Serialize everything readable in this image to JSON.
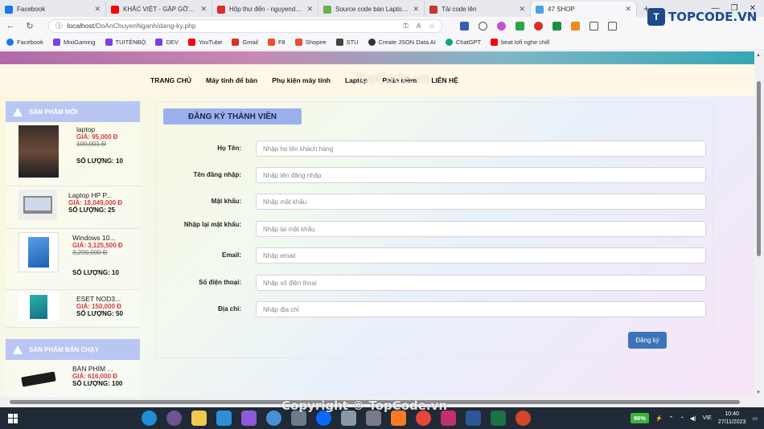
{
  "browser": {
    "tabs": [
      {
        "title": "Facebook",
        "color": "#1877f2"
      },
      {
        "title": "KHẮC VIỆT - GẶP GỠ ĐỂ CHIA LY",
        "color": "#ff0000"
      },
      {
        "title": "Hộp thư đến - nguyenducch",
        "color": "#d93025"
      },
      {
        "title": "Source code bán Laptop - P",
        "color": "#6ab04c"
      },
      {
        "title": "Tải code lên",
        "color": "#c0392b"
      },
      {
        "title": "47 SHOP",
        "color": "#4aa3df"
      }
    ],
    "url_host": "localhost",
    "url_path": "/DoAnChuyenNganh/dang-ky.php",
    "bookmarks": [
      {
        "label": "Facebook",
        "color": "#1877f2"
      },
      {
        "label": "MixiGaming",
        "color": "#7b3fe4"
      },
      {
        "label": "TUITÈNBỘ",
        "color": "#7b3fe4"
      },
      {
        "label": "DEV",
        "color": "#7b3fe4"
      },
      {
        "label": "YouTube",
        "color": "#ff0000"
      },
      {
        "label": "Gmail",
        "color": "#d93025"
      },
      {
        "label": "F8",
        "color": "#f05123"
      },
      {
        "label": "Shopee",
        "color": "#ee4d2d"
      },
      {
        "label": "STU",
        "color": "#444444"
      },
      {
        "label": "Create JSON Data AI",
        "color": "#333333"
      },
      {
        "label": "ChatGPT",
        "color": "#10a37f"
      },
      {
        "label": "beat lofi nghe chill",
        "color": "#ff0000"
      }
    ]
  },
  "site_logo": "TOPCODE.VN",
  "nav": {
    "items": [
      "TRANG CHỦ",
      "Máy tính để bàn",
      "Phụ kiện máy tính",
      "Laptop",
      "Phần mềm",
      "LIÊN HỆ"
    ]
  },
  "watermark": "TopCode.vn",
  "sidebar": {
    "new_products_title": "SẢN PHẨM MỚI",
    "new_products": [
      {
        "name": "laptop",
        "price": "GIÁ: 95,000 Đ",
        "old_price": "100,001 Đ",
        "qty": "SỐ LƯỢNG: 10"
      },
      {
        "name": "Laptop HP P...",
        "price": "GIÁ: 18,049,000 Đ",
        "old_price": "",
        "qty": "SỐ LƯỢNG: 25"
      },
      {
        "name": "Windows 10...",
        "price": "GIÁ: 3,125,500 Đ",
        "old_price": "3,290,000 Đ",
        "qty": "SỐ LƯỢNG: 10"
      },
      {
        "name": "ESET NOD3...",
        "price": "GIÁ: 150,000 Đ",
        "old_price": "",
        "qty": "SỐ LƯỢNG: 50"
      }
    ],
    "best_sellers_title": "SẢN PHẨM BÁN CHẠY",
    "best_sellers": [
      {
        "name": "BÀN PHÍM ...",
        "price": "GIÁ: 616,000 Đ",
        "qty": "SỐ LƯỢNG: 100"
      }
    ]
  },
  "form": {
    "title": "ĐĂNG KÝ THÀNH VIÊN",
    "fields": [
      {
        "label": "Họ Tên:",
        "placeholder": "Nhập họ tên khách hàng"
      },
      {
        "label": "Tên đăng nhập:",
        "placeholder": "Nhập tên đăng nhập"
      },
      {
        "label": "Mật khẩu:",
        "placeholder": "Nhập mật khẩu"
      },
      {
        "label": "Nhập lại mật khẩu:",
        "placeholder": "Nhập lại mật khẩu"
      },
      {
        "label": "Email:",
        "placeholder": "Nhập email"
      },
      {
        "label": "Số điện thoại:",
        "placeholder": "Nhập số điện thoại"
      },
      {
        "label": "Địa chỉ:",
        "placeholder": "Nhập địa chỉ"
      }
    ],
    "submit_label": "Đăng ký"
  },
  "footer_watermark": "Copyright © TopCode.vn",
  "taskbar": {
    "battery": "96%",
    "lang": "VIE",
    "time": "10:40",
    "date": "27/11/2023"
  }
}
